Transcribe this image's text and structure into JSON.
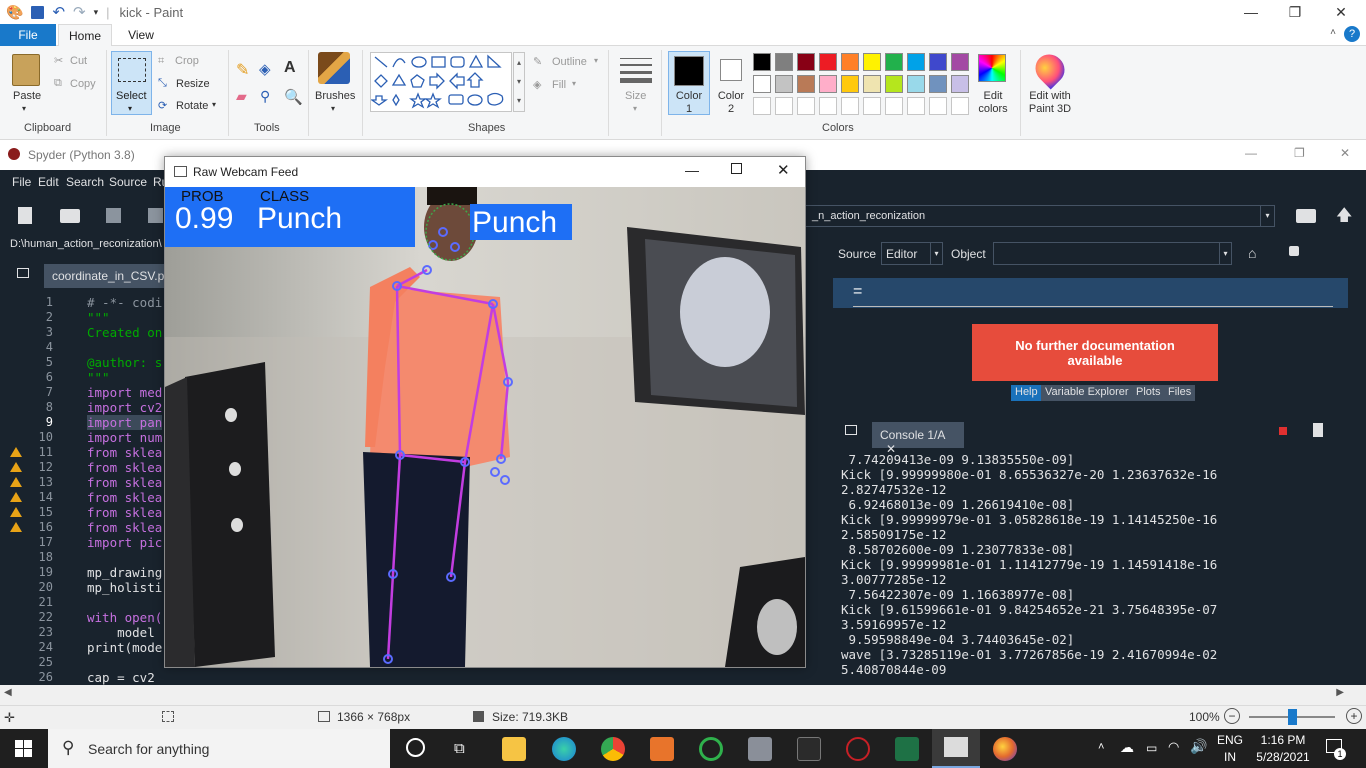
{
  "paint": {
    "title": "kick - Paint",
    "tabs": [
      "File",
      "Home",
      "View"
    ],
    "groups": {
      "clipboard": {
        "label": "Clipboard",
        "paste": "Paste",
        "cut": "Cut",
        "copy": "Copy"
      },
      "image": {
        "label": "Image",
        "select": "Select",
        "crop": "Crop",
        "resize": "Resize",
        "rotate": "Rotate"
      },
      "tools": {
        "label": "Tools"
      },
      "brushes": {
        "label": "Brushes"
      },
      "shapes": {
        "label": "Shapes",
        "outline": "Outline",
        "fill": "Fill"
      },
      "size": {
        "label": "Size"
      },
      "color1": "Color\n1",
      "color2": "Color\n2",
      "colors": {
        "label": "Colors",
        "edit": "Edit\ncolors"
      },
      "paint3d": "Edit with\nPaint 3D"
    },
    "palette_row1": [
      "#000000",
      "#7f7f7f",
      "#880015",
      "#ed1c24",
      "#ff7f27",
      "#fff200",
      "#22b14c",
      "#00a2e8",
      "#3f48cc",
      "#a349a4"
    ],
    "palette_row2": [
      "#ffffff",
      "#c3c3c3",
      "#b97a57",
      "#ffaec9",
      "#ffc90e",
      "#efe4b0",
      "#b5e61d",
      "#99d9ea",
      "#7092be",
      "#c8bfe7"
    ],
    "status": {
      "dimensions": "1366 × 768px",
      "size": "Size: 719.3KB",
      "zoom": "100%"
    }
  },
  "spyder": {
    "title": "Spyder (Python 3.8)",
    "menu": [
      "File",
      "Edit",
      "Search",
      "Source",
      "Ru"
    ],
    "path": "D:\\human_action_reconization\\",
    "file_tab": "coordinate_in_CSV.py",
    "working_dir": "_n_action_reconization",
    "editor_lines": [
      {
        "n": "1",
        "text": "# -*- codi",
        "color": "#8b949e",
        "warn": false
      },
      {
        "n": "2",
        "text": "\"\"\"",
        "color": "#00aa00",
        "warn": false
      },
      {
        "n": "3",
        "text": "Created on",
        "color": "#00aa00",
        "warn": false
      },
      {
        "n": "4",
        "text": "",
        "color": "#00aa00",
        "warn": false
      },
      {
        "n": "5",
        "text": "@author: s",
        "color": "#00aa00",
        "warn": false
      },
      {
        "n": "6",
        "text": "\"\"\"",
        "color": "#00aa00",
        "warn": false
      },
      {
        "n": "7",
        "text": "import med",
        "color": "#c670e0",
        "warn": false
      },
      {
        "n": "8",
        "text": "import cv2",
        "color": "#c670e0",
        "warn": false
      },
      {
        "n": "9",
        "text": "import pan",
        "color": "#c670e0",
        "warn": false
      },
      {
        "n": "10",
        "text": "import num",
        "color": "#c670e0",
        "warn": false
      },
      {
        "n": "11",
        "text": "from sklea",
        "color": "#c670e0",
        "warn": true
      },
      {
        "n": "12",
        "text": "from sklea",
        "color": "#c670e0",
        "warn": true
      },
      {
        "n": "13",
        "text": "from sklea",
        "color": "#c670e0",
        "warn": true
      },
      {
        "n": "14",
        "text": "from sklea",
        "color": "#c670e0",
        "warn": true
      },
      {
        "n": "15",
        "text": "from sklea",
        "color": "#c670e0",
        "warn": true
      },
      {
        "n": "16",
        "text": "from sklea",
        "color": "#c670e0",
        "warn": true
      },
      {
        "n": "17",
        "text": "import pic",
        "color": "#c670e0",
        "warn": false
      },
      {
        "n": "18",
        "text": "",
        "color": "#e0e1e3",
        "warn": false
      },
      {
        "n": "19",
        "text": "mp_drawing",
        "color": "#e0e1e3",
        "warn": false
      },
      {
        "n": "20",
        "text": "mp_holisti",
        "color": "#e0e1e3",
        "warn": false
      },
      {
        "n": "21",
        "text": "",
        "color": "#e0e1e3",
        "warn": false
      },
      {
        "n": "22",
        "text": "with open(",
        "color": "#c670e0",
        "warn": false
      },
      {
        "n": "23",
        "text": "    model",
        "color": "#e0e1e3",
        "warn": false
      },
      {
        "n": "24",
        "text": "print(mode",
        "color": "#e0e1e3",
        "warn": false
      },
      {
        "n": "25",
        "text": "",
        "color": "#e0e1e3",
        "warn": false
      },
      {
        "n": "26",
        "text": "cap = cv2",
        "color": "#e0e1e3",
        "warn": false
      }
    ],
    "help": {
      "source_label": "Source",
      "source_value": "Editor",
      "object_label": "Object",
      "equals": "=",
      "no_doc": "No further documentation available",
      "tabs": [
        "Help",
        "Variable Explorer",
        "Plots",
        "Files"
      ]
    },
    "console_tab": "Console 1/A",
    "console_lines": [
      " 7.74209413e-09 9.13835550e-09]",
      "Kick [9.99999980e-01 8.65536327e-20 1.23637632e-16",
      "2.82747532e-12",
      " 6.92468013e-09 1.26619410e-08]",
      "Kick [9.99999979e-01 3.05828618e-19 1.14145250e-16",
      "2.58509175e-12",
      " 8.58702600e-09 1.23077833e-08]",
      "Kick [9.99999981e-01 1.11412779e-19 1.14591418e-16",
      "3.00777285e-12",
      " 7.56422307e-09 1.16638977e-08]",
      "Kick [9.61599661e-01 9.84254652e-21 3.75648395e-07",
      "3.59169957e-12",
      " 9.59598849e-04 3.74403645e-02]",
      "wave [3.73285119e-01 3.77267856e-19 2.41670994e-02",
      "5.40870844e-09"
    ]
  },
  "webcam": {
    "title": "Raw Webcam Feed",
    "prob_label": "PROB",
    "class_label": "CLASS",
    "prob_value": "0.99",
    "class_value": "Punch",
    "overlay_class": "Punch"
  },
  "taskbar": {
    "search_placeholder": "Search for anything",
    "lang": "ENG",
    "region": "IN",
    "time": "1:16 PM",
    "date": "5/28/2021",
    "notif_count": "1"
  }
}
